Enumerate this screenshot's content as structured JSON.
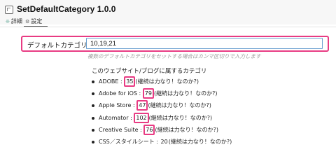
{
  "plugin": {
    "title": "SetDefaultCategory 1.0.0"
  },
  "tabs": [
    {
      "label": "詳細",
      "icon": "details-icon",
      "active": false
    },
    {
      "label": "設定",
      "icon": "settings-icon",
      "active": true
    }
  ],
  "setting": {
    "label": "デフォルトカテゴリ",
    "value": "10,19,21",
    "hint": "複数のデフォルトカテゴリをセットする場合はカンマ区切りで入力します"
  },
  "blog": {
    "heading": "このウェブサイト/ブログに属するカテゴリ"
  },
  "categories": [
    {
      "name": "ADOBE",
      "sep": " : ",
      "id": "35",
      "note": "(継続は力なり！なのか?)",
      "highlighted": true
    },
    {
      "name": "Adobe for iOS",
      "sep": " : ",
      "id": "79",
      "note": "(継続は力なり！なのか?)",
      "highlighted": true
    },
    {
      "name": "Apple Store",
      "sep": " : ",
      "id": "47",
      "note": "(継続は力なり！なのか?)",
      "highlighted": true
    },
    {
      "name": "Automator",
      "sep": " : ",
      "id": "102",
      "note": "(継続は力なり！なのか?)",
      "highlighted": true
    },
    {
      "name": "Creative Suite",
      "sep": " : ",
      "id": "76",
      "note": "(継続は力なり！なのか?)",
      "highlighted": true
    },
    {
      "name": "CSS／スタイルシート",
      "sep": " : ",
      "id": "20",
      "note": "(継続は力なり！なのか?)",
      "highlighted": false
    }
  ],
  "colors": {
    "highlight": "#e83b83",
    "input_border": "#6aa0d0",
    "hint_text": "#9a9a9a"
  }
}
